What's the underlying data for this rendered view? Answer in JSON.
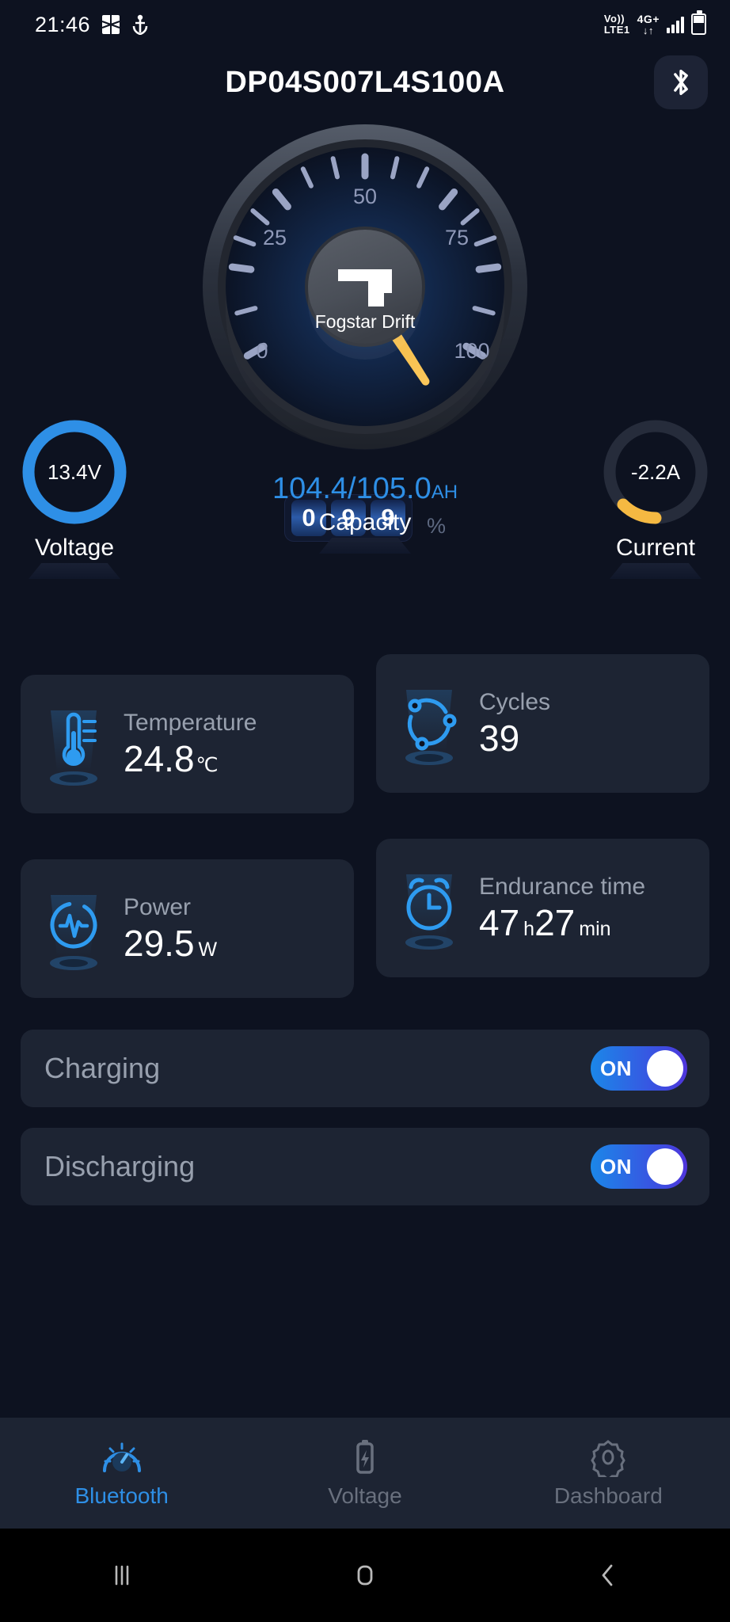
{
  "status_bar": {
    "time": "21:46",
    "icons_left": [
      "sim-card-icon",
      "anchor-icon"
    ],
    "volte": "Vo))",
    "volte_sub": "LTE1",
    "network": "4G+",
    "data_arrows": "↓↑",
    "signal": "signal-bars-icon",
    "battery": "battery-icon"
  },
  "header": {
    "title": "DP04S007L4S100A",
    "bluetooth_button": "bluetooth-icon"
  },
  "gauge": {
    "brand": "Fogstar Drift",
    "tick_labels": [
      "0",
      "25",
      "50",
      "75",
      "100"
    ],
    "min": 0,
    "max": 100,
    "value": 99,
    "needle_color": "#f5b942",
    "digits": [
      "0",
      "9",
      "9"
    ],
    "percent_symbol": "%"
  },
  "meters": {
    "voltage": {
      "value": "13.4V",
      "label": "Voltage",
      "ring_color": "#2e8fe6",
      "fill": 100
    },
    "capacity": {
      "value": "104.4/105.0",
      "unit": "AH",
      "label": "Capacity",
      "color": "#2e8fe6"
    },
    "current": {
      "value": "-2.2A",
      "label": "Current",
      "ring_color": "#f5b942",
      "fill": 14
    }
  },
  "cards": [
    {
      "icon": "thermometer-icon",
      "label": "Temperature",
      "value": "24.8",
      "unit": "℃"
    },
    {
      "icon": "cycles-icon",
      "label": "Cycles",
      "value": "39",
      "unit": ""
    },
    {
      "icon": "power-pulse-icon",
      "label": "Power",
      "value": "29.5",
      "unit": "W"
    },
    {
      "icon": "alarm-clock-icon",
      "label": "Endurance time",
      "value": "47",
      "unit": "h",
      "value2": "27",
      "unit2": "min"
    }
  ],
  "toggles": [
    {
      "label": "Charging",
      "state": "ON"
    },
    {
      "label": "Discharging",
      "state": "ON"
    }
  ],
  "bottom_nav": [
    {
      "icon": "speedometer-icon",
      "label": "Bluetooth",
      "active": true
    },
    {
      "icon": "battery-bolt-icon",
      "label": "Voltage",
      "active": false
    },
    {
      "icon": "gear-icon",
      "label": "Dashboard",
      "active": false
    }
  ],
  "android_nav": [
    "recents-icon",
    "home-icon",
    "back-icon"
  ],
  "colors": {
    "accent": "#2e8fe6",
    "warn": "#f5b942",
    "card": "#1d2433",
    "bg": "#0d1220"
  }
}
